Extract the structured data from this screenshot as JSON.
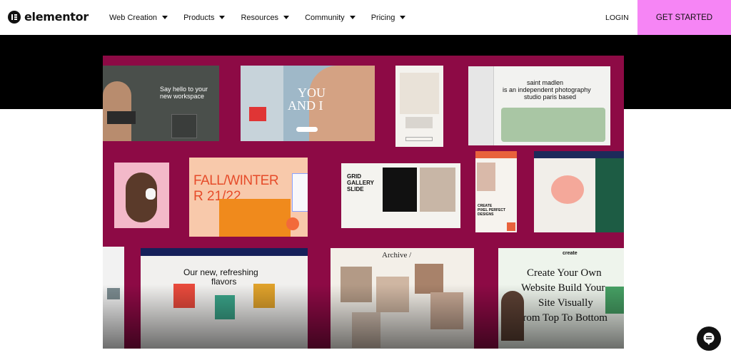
{
  "header": {
    "logo_text": "elementor",
    "nav": [
      {
        "label": "Web Creation"
      },
      {
        "label": "Products"
      },
      {
        "label": "Resources"
      },
      {
        "label": "Community"
      },
      {
        "label": "Pricing"
      }
    ],
    "login_label": "LOGIN",
    "cta_label": "GET STARTED",
    "cta_color": "#f685f5"
  },
  "showcase": {
    "background_color": "#8d0a45",
    "cards": {
      "workspace": {
        "headline_1": "Say hello to your",
        "headline_2": "new workspace"
      },
      "you_and_i": {
        "headline_1": "YOU",
        "headline_2": "AND I"
      },
      "madlen": {
        "line_1": "saint madlen",
        "line_2": "is an independent photography",
        "line_3": "studio paris based"
      },
      "fall_winter": {
        "line_1": "FALL/WINTER",
        "line_2": "R 21/22"
      },
      "grid_gallery": {
        "line_1": "GRID",
        "line_2": "GALLERY",
        "line_3": "SLIDE"
      },
      "pixel_perfect": {
        "line_1": "CREATE",
        "line_2": "PIXEL PERFECT",
        "line_3": "DESIGNS"
      },
      "flavors": {
        "line_1": "Our new, refreshing",
        "line_2": "flavors"
      },
      "archive": {
        "title": "Archive /"
      },
      "create_site": {
        "brand": "create",
        "line_1": "Create Your Own",
        "line_2": "Website Build Your",
        "line_3": "Site Visually",
        "line_4": "From Top To Bottom"
      }
    }
  },
  "chat": {
    "icon": "chat-icon"
  }
}
